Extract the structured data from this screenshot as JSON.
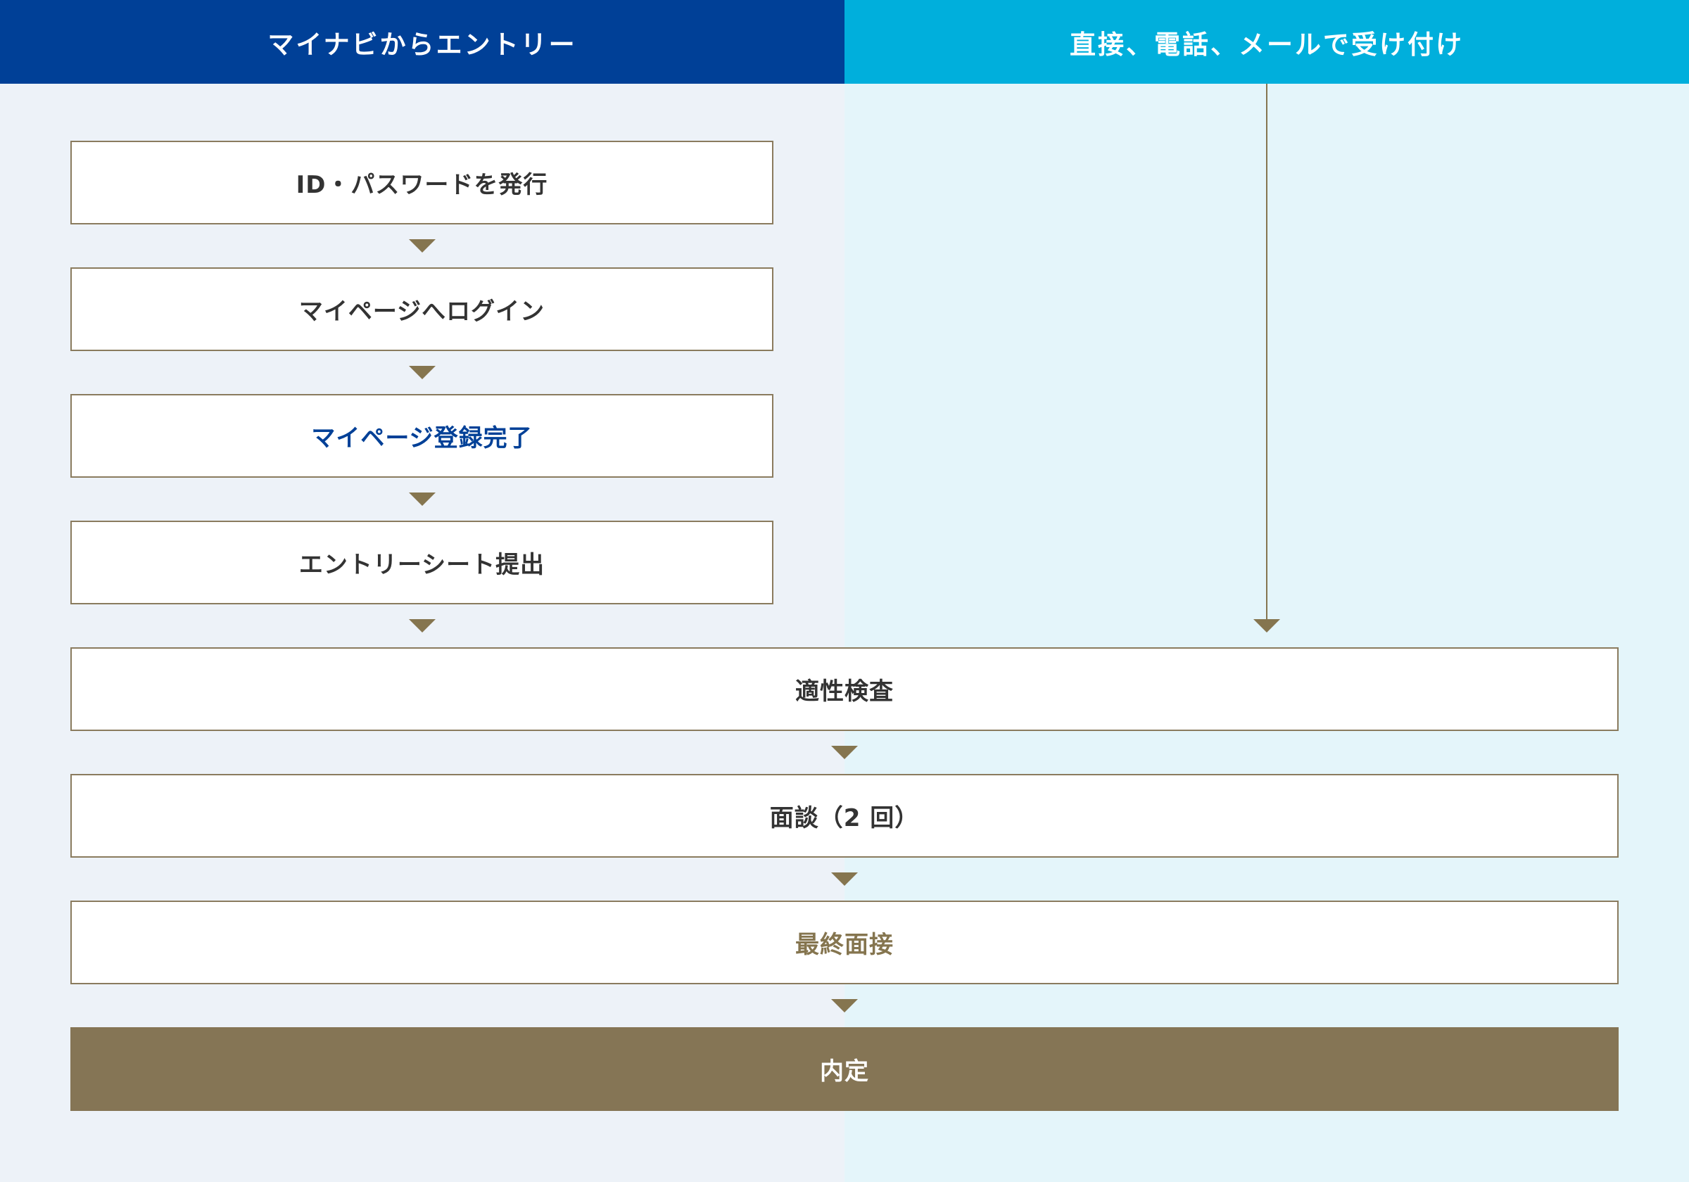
{
  "headers": {
    "left": "マイナビからエントリー",
    "right": "直接、電話、メールで受け付け"
  },
  "steps": {
    "issue_id": "ID・パスワードを発行",
    "login": "マイページへログイン",
    "register_complete": "マイページ登録完了",
    "entry_sheet": "エントリーシート提出",
    "aptitude_test": "適性検査",
    "interview": "面談（2 回）",
    "final_interview": "最終面接",
    "offer": "内定"
  },
  "colors": {
    "left_header": "#004097",
    "right_header": "#00afdc",
    "left_background": "#edf2f8",
    "right_background": "#e4f5fa",
    "accent_brown": "#857555",
    "accent_blue_text": "#004097"
  }
}
